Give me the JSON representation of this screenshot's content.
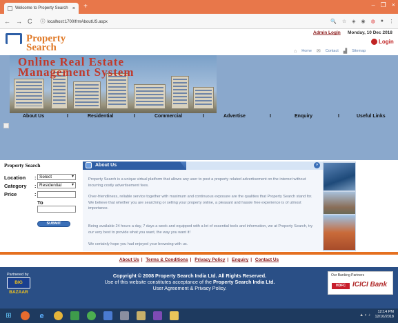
{
  "browser": {
    "tab_title": "Welcome to Property Search",
    "tab_close": "×",
    "new_tab": "+",
    "url": "localhost:1700/frmAboutUS.aspx",
    "win_controls": [
      "–",
      "❐",
      "×"
    ]
  },
  "header": {
    "logo_line1": "Property",
    "logo_line2": "Search",
    "admin_login": "Admin Login",
    "date": "Monday, 10 Dec 2018",
    "login": "Login",
    "top_links": [
      "Home",
      "Contact",
      "Sitemap"
    ]
  },
  "banner": {
    "title_line1": "Online Real Estate",
    "title_line2": "Management System"
  },
  "nav": {
    "items": [
      "About Us",
      "Residential",
      "Commercial",
      "Advertise",
      "Enquiry",
      "Useful Links"
    ],
    "separator": "I"
  },
  "sidebar": {
    "title": "Property Search",
    "location_label": "Location",
    "location_value": "Select",
    "category_label": "Category",
    "category_value": "Residential",
    "price_label": "Price",
    "to_label": "To",
    "colon": ":",
    "submit": "SUBMIT"
  },
  "about": {
    "title": "About Us",
    "paragraphs": [
      "Property Search is a unique virtual platform that allows any user to post a property related advertisement on the internet without incurring costly advertisement fees.",
      "Over-friendliness, reliable service together with maximum and continuous exposure are the qualities that Property Search stand for. We believe that whether you are searching or selling your property online, a pleasant and hassle free experience is of utmost importance.",
      "Being available 24 hours a day, 7 days a week and equipped with a lot of essential tools and information, we at Property Search, try our very best to provide what you want, the way you want it!",
      "We certainly hope you had enjoyed your browsing with us."
    ]
  },
  "footer": {
    "links": [
      "About Us",
      "Terms & Conditions",
      "Privacy Policy",
      "Enquiry",
      "Contact Us"
    ],
    "partner_label": "Partnered by",
    "partner_name": "BIG BAZAAR",
    "copy_line1": "Copyright © 2008 Property Search India Ltd. All Rights Reserved.",
    "copy_line2_pre": "Use of this website constitutes acceptance of the ",
    "copy_line2_bold": "Property Search India Ltd.",
    "copy_line3": "User Agreement & Privacy Policy.",
    "banking_label": "Our Banking Partners",
    "bank1": "HDFC",
    "bank2": "ICICI Bank"
  },
  "taskbar": {
    "time": "12:14 PM",
    "date": "12/10/2018"
  }
}
